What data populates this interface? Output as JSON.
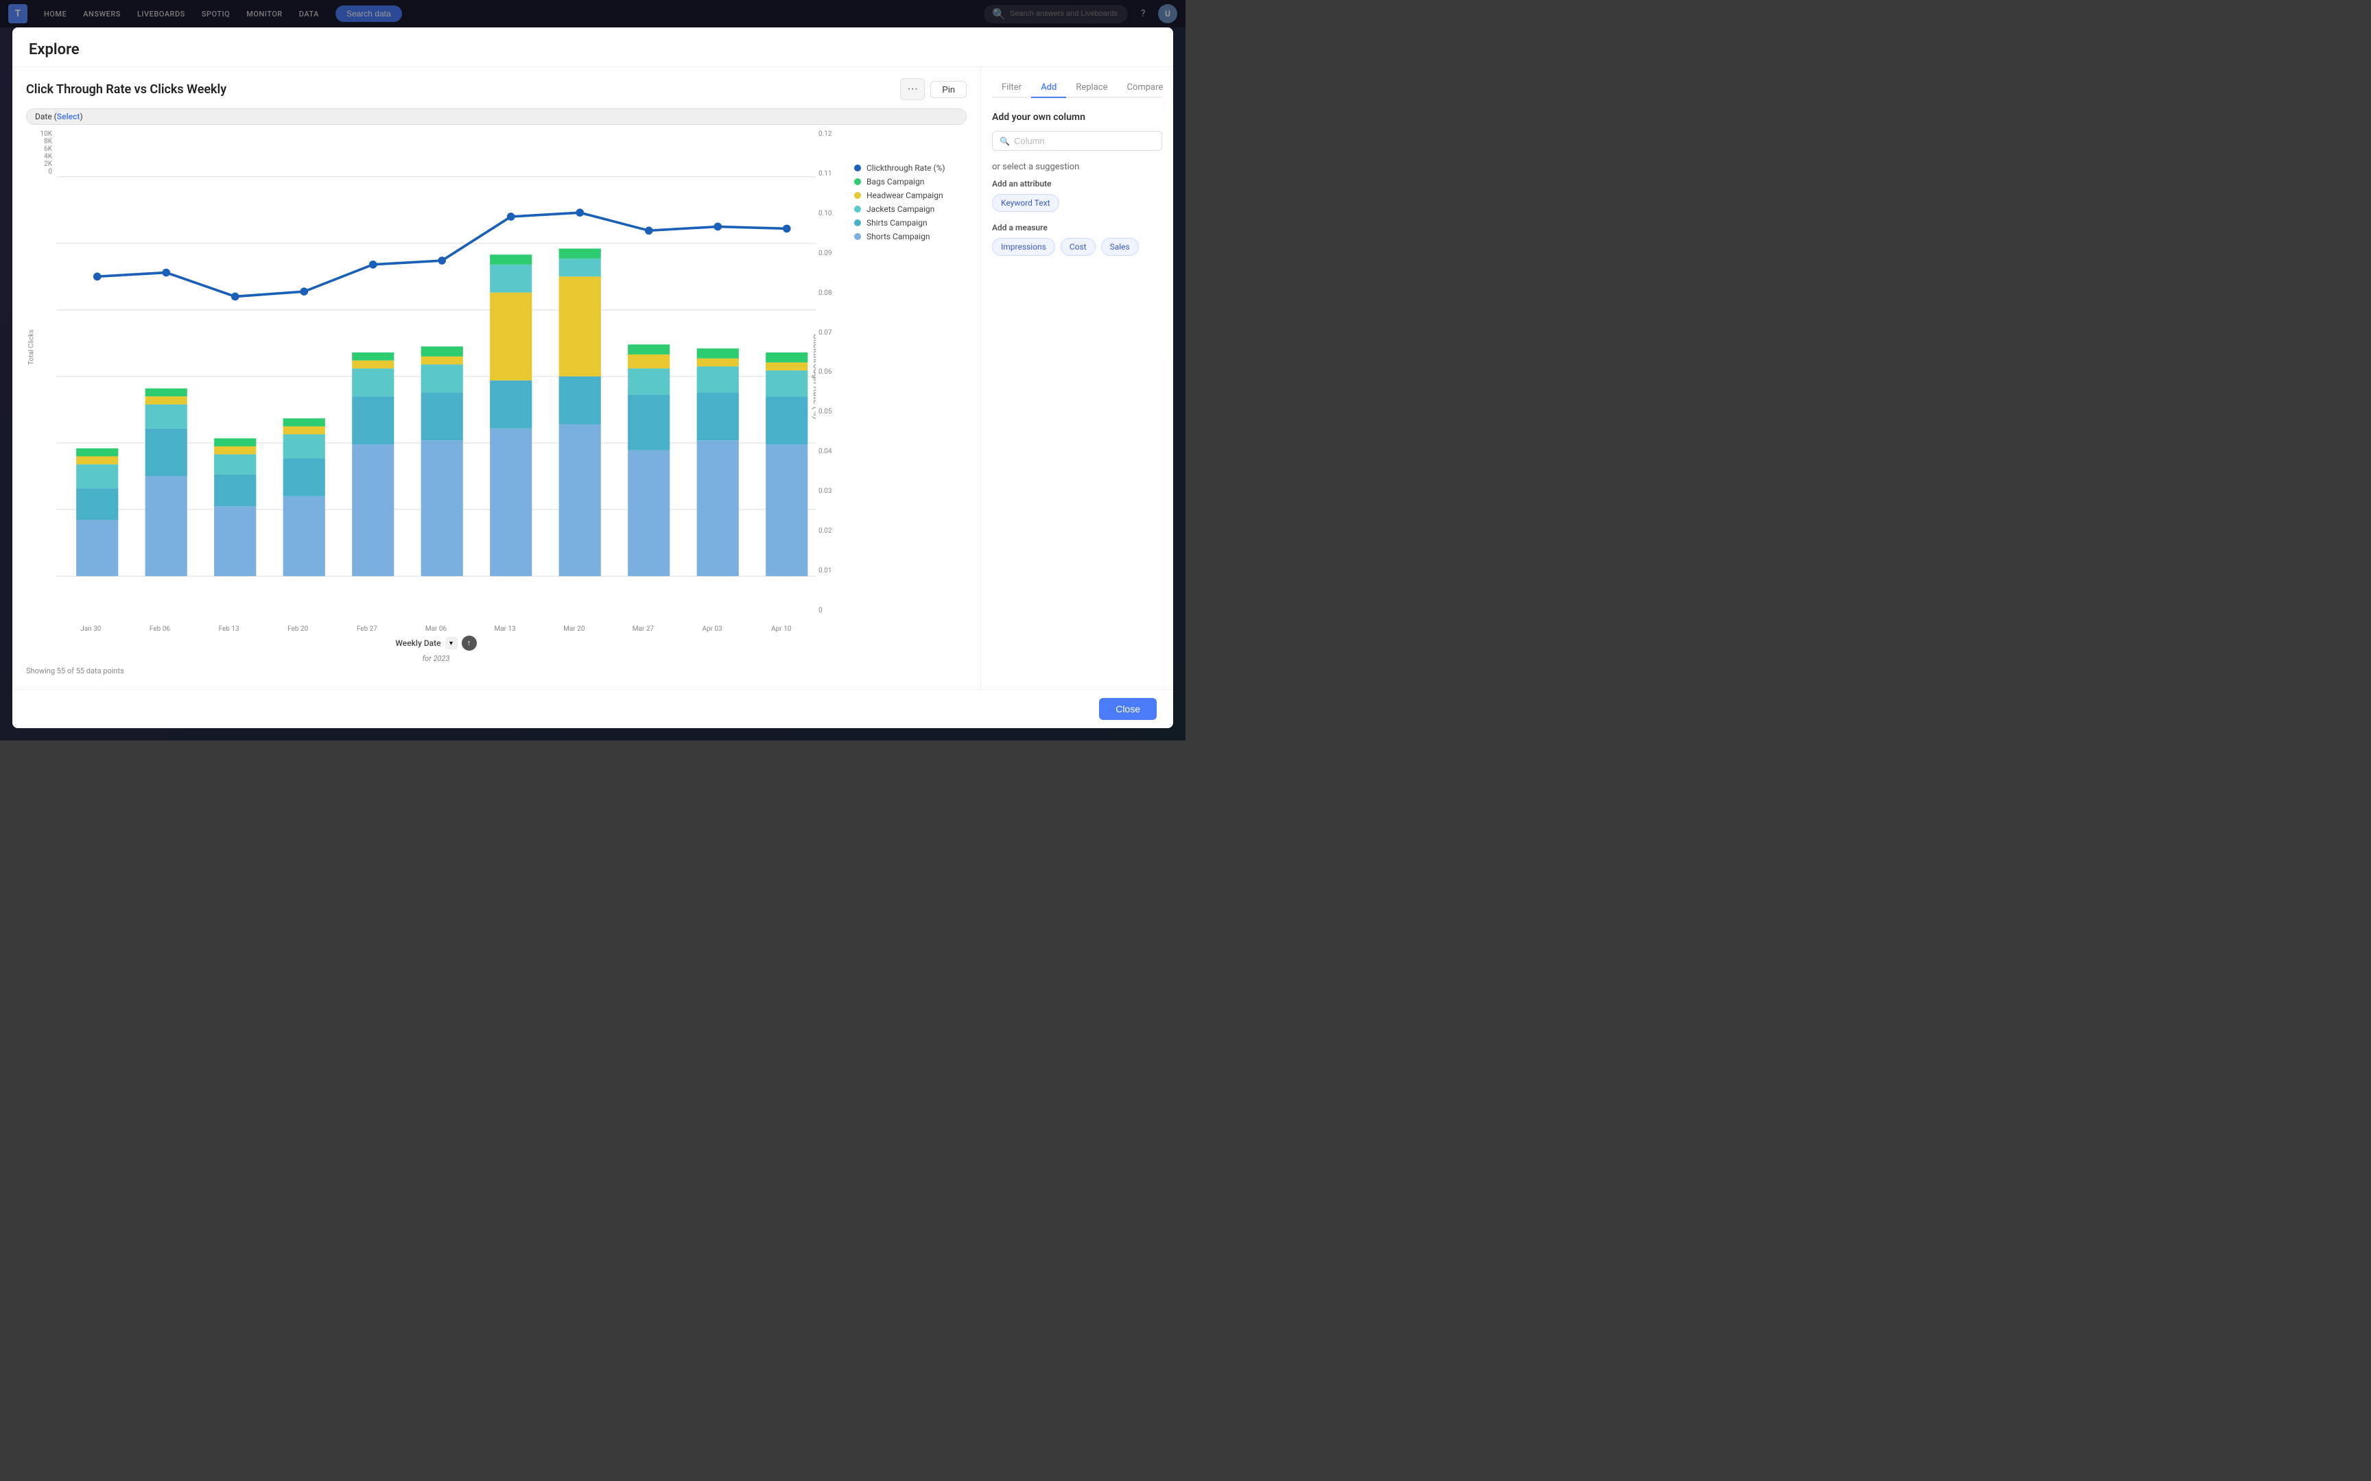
{
  "nav": {
    "logo": "T",
    "items": [
      "HOME",
      "ANSWERS",
      "LIVEBOARDS",
      "SPOTIQ",
      "MONITOR",
      "DATA"
    ],
    "search_btn": "Search data",
    "search_placeholder": "Search answers and Liveboards"
  },
  "dialog": {
    "title": "Explore",
    "chart": {
      "title": "Click Through Rate vs Clicks Weekly",
      "more_btn": "···",
      "pin_btn": "Pin",
      "date_filter": "Date (Select)",
      "date_filter_pre": "Date (",
      "date_filter_highlight": "Select",
      "date_filter_post": ")",
      "footer": "Showing 55 of 55 data points",
      "weekly_date_label": "Weekly Date",
      "weekly_date_sub": "for 2023",
      "y_left_ticks": [
        "10K",
        "8K",
        "6K",
        "4K",
        "2K",
        "0"
      ],
      "y_left_label": "Total Clicks",
      "y_right_ticks": [
        "0.12",
        "0.11",
        "0.10",
        "0.09",
        "0.08",
        "0.07",
        "0.06",
        "0.05",
        "0.04",
        "0.03",
        "0.02",
        "0.01",
        "0"
      ],
      "y_right_label": "Clickthrough Rate (%)",
      "x_labels": [
        "Jan 30",
        "Feb 06",
        "Feb 13",
        "Feb 20",
        "Feb 27",
        "Mar 06",
        "Mar 13",
        "Mar 20",
        "Mar 27",
        "Apr 03",
        "Apr 10"
      ],
      "legend": [
        {
          "label": "Clickthrough Rate (%)",
          "color": "#1a5fb8"
        },
        {
          "label": "Bags Campaign",
          "color": "#2ecc71"
        },
        {
          "label": "Headwear Campaign",
          "color": "#e8c830"
        },
        {
          "label": "Jackets Campaign",
          "color": "#5ac8c8"
        },
        {
          "label": "Shirts Campaign",
          "color": "#48b0c8"
        },
        {
          "label": "Shorts Campaign",
          "color": "#7ab0e0"
        }
      ]
    },
    "panel": {
      "tabs": [
        "Filter",
        "Add",
        "Replace",
        "Compare"
      ],
      "active_tab": "Add",
      "section_title": "Add your own column",
      "column_placeholder": "Column",
      "suggestion_title": "or select a suggestion",
      "add_attribute_label": "Add an attribute",
      "attributes": [
        "Keyword Text"
      ],
      "add_measure_label": "Add a measure",
      "measures": [
        "Impressions",
        "Cost",
        "Sales"
      ]
    },
    "close_btn": "Close"
  }
}
